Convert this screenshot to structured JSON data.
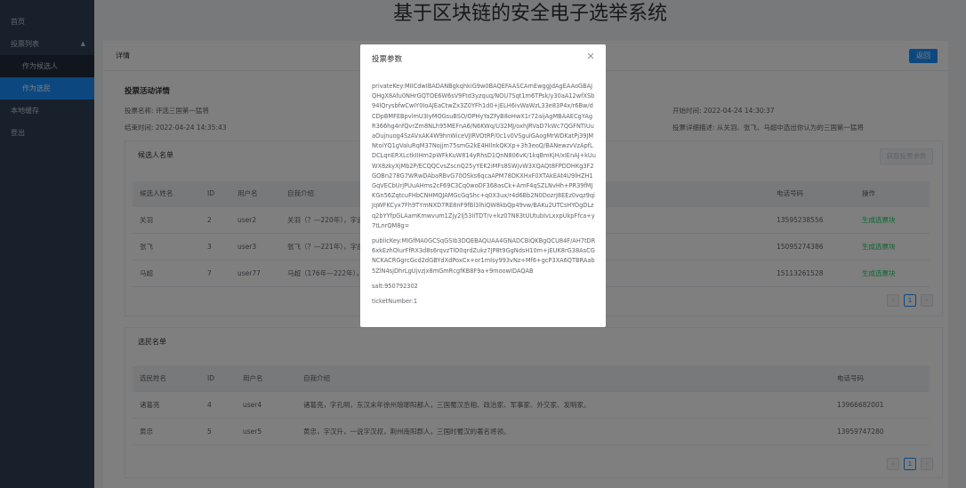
{
  "sidebar": {
    "items": [
      {
        "label": "首页"
      },
      {
        "label": "投票列表"
      },
      {
        "label": "作为候选人"
      },
      {
        "label": "作为选民"
      },
      {
        "label": "本地缓存"
      },
      {
        "label": "登出"
      }
    ]
  },
  "header": {
    "title": "基于区块链的安全电子选举系统"
  },
  "card": {
    "title": "详情",
    "back_label": "返回"
  },
  "activity": {
    "heading": "投票活动详情",
    "name_label": "投票名称:",
    "name_value": "评选三国第一猛将",
    "end_label": "结束时间:",
    "end_value": "2022-04-24 14:35:43",
    "start_label": "开始时间:",
    "start_value": "2022-04-24 14:30:37",
    "desc_label": "投票详细描述:",
    "desc_value": "从关羽、张飞、马超中选出你认为的三国第一猛将"
  },
  "candidates": {
    "title": "候选人名单",
    "fetch_label": "获取投票参数",
    "columns": [
      "候选人姓名",
      "ID",
      "用户名",
      "自我介绍",
      "电话号码",
      "操作"
    ],
    "rows": [
      {
        "name": "关羽",
        "id": "2",
        "user": "user2",
        "intro": "关羽（？—220年），字云长",
        "phone": "13595238556",
        "action": "生成选票块"
      },
      {
        "name": "张飞",
        "id": "3",
        "user": "user3",
        "intro": "张飞（？—221年），字益德",
        "phone": "15095274386",
        "action": "生成选票块"
      },
      {
        "name": "马超",
        "id": "7",
        "user": "user77",
        "intro": "马超（176年—222年），字孟起",
        "phone": "15113261528",
        "action": "生成选票块"
      }
    ],
    "page": "1"
  },
  "voters": {
    "title": "选民名单",
    "columns": [
      "选民姓名",
      "ID",
      "用户名",
      "自我介绍",
      "电话号码"
    ],
    "rows": [
      {
        "name": "诸葛亮",
        "id": "4",
        "user": "user4",
        "intro": "诸葛亮，字孔明，东汉末年徐州琅琊阳都人，三国蜀汉丞相、政治家、军事家、外交家、发明家。",
        "phone": "13966682001"
      },
      {
        "name": "黄忠",
        "id": "5",
        "user": "user5",
        "intro": "黄忠，字汉升，一说字汉叔，荆州南阳郡人，三国时蜀汉的著名将领。",
        "phone": "13959747280"
      }
    ],
    "page": "1"
  },
  "modal": {
    "title": "投票参数",
    "private_key": "privateKey:MIICdwIBADANBgkqhkiG9w0BAQEFAASCAmEwggJdAgEAAoGBAJQHgX8Afu0NHrGQTOE6W6sV9Ftd3yzquq/NOU7Sqt1m6TPsk/y30aA12wfXSb94lQrysbfwCwIY0IoAJEaCtwZx3Z0YFh1d0+jELH6ivWaWzL33e83P4x/r6Bw/dCDpBMFEBpvlmU3IyMOGsuBSO/OPHyYaZFyB8oHwX1r72aijAgMBAAECgYAgR366hg4nfQvrZm8NLh95MEFnA6/N6KWq/U32MJ/oxhJRVaD7kWc7QGFNTIUuaOujnuog4SzAVxAK4W9hnWiceVJIRVOtRP/0c1v0VSgulGAogMrWDKatPj39JMNtoiYQ1gValuRqM37Nojjm75smG2kE4HIlnkQKXp+3h3eoQ/BANewzvVzApfLDCLqnERXLctkIIHm2pWFkKuW814yRhsD1QnN806vK/1kqBmKjH/xIEnAJ+kUuWX8zkyXjMb2P/ECQQCvsZscnQ25yYEK2iMFs8SWjvW3XQAQt8FPDDHKg3F2GOBn278G7WRwDAbaRBvG70OSks6qcaAPM78DKXHxF0XTAkEAt4U9lHZH1GqVECbUrjPUuAHms2cF69C3Cq0woDF368asCk+AmF4qSZLNvHh+PR39fMJKGn56ZqtcuFHbCNHMQJAMGcGqShc+q0X3ux/r4d6Bb2N0DozrJ8EEz0vqz9qiJqWFKCyx7Fh9TYmNXD7RE8nF9fBl3lhiQW8kbQp49vw/BAKu2UTCsHYOgDLzq2bYYfpGLAamKmwvum1Zjy2lj53IiTDT/v+kz07N83tUUtubIvLxxpUkpFfca+y7tLnrQM8g=",
    "public_key": "publicKey:MIGfMA0GCSqGSIb3DQEBAQUAA4GNADCBiQKBgQCU84F/AH7tDR6xkEzhOlurFfRX3d8s6rqvzTlO0qrdZukz7JP8t9GgNdsH10m+jEUK8rG38AsCGNCKACRGgrcGcd2dGBYdXdPoxCx+or1mIsy993vNz+Mf6+gcP3XA6QTBRAab5ZlN4sjDhrLgUjvzjx8mGmRcgfKB8F9a+9moowIDAQAB",
    "salt": "salt:950792302",
    "ticket": "ticketNumber:1"
  },
  "icons": {
    "close": "close-icon",
    "chevron": "chevron-up-icon"
  }
}
